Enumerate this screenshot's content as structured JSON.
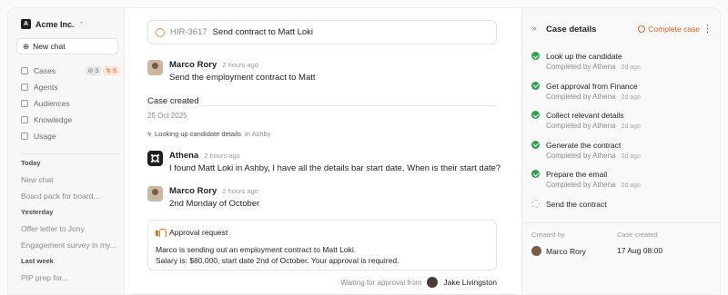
{
  "org": {
    "logo_letter": "A",
    "name": "Acme Inc."
  },
  "sidebar": {
    "new_chat": "New chat",
    "nav": [
      {
        "label": "Cases",
        "icon": "cases-icon",
        "badges": [
          "3",
          "6"
        ]
      },
      {
        "label": "Agents",
        "icon": "agents-icon"
      },
      {
        "label": "Audiences",
        "icon": "audiences-icon"
      },
      {
        "label": "Knowledge",
        "icon": "knowledge-icon"
      },
      {
        "label": "Usage",
        "icon": "usage-icon"
      }
    ],
    "sections": [
      {
        "heading": "Today",
        "items": [
          "New chat",
          "Board pack for board..."
        ]
      },
      {
        "heading": "Yesterday",
        "items": [
          "Offer letter to Jony",
          "Engagement survey in my..."
        ]
      },
      {
        "heading": "Last week",
        "items": [
          "PIP prep for..."
        ]
      }
    ]
  },
  "case": {
    "id": "HIR-3617",
    "title": "Send contract to Matt Loki"
  },
  "messages": [
    {
      "author": "Marco Rory",
      "time": "2 hours ago",
      "body": "Send the employment contract to Matt"
    },
    {
      "author": "Athena",
      "time": "2 hours ago",
      "body": "I found Matt Loki in Ashby, I have all the details bar start date. When is their start date?"
    },
    {
      "author": "Marco Rory",
      "time": "2 hours ago",
      "body": "2nd Monday of October"
    }
  ],
  "case_created": {
    "label": "Case created",
    "date": "25 Oct 2025"
  },
  "lookup": {
    "text": "Looking up candidate details",
    "source": "in Ashby"
  },
  "approval": {
    "title": "Approval request",
    "line1": "Marco is sending out an employment contract to Matt Loki.",
    "line2": "Salary is: $80,000, start date 2nd of October. Your approval is required."
  },
  "waiting": {
    "label": "Waiting for approval from",
    "name": "Jake Livingston"
  },
  "panel": {
    "title": "Case details",
    "complete_label": "Complete case",
    "steps": [
      {
        "title": "Look up the candidate",
        "meta": "Completed by Athena",
        "ago": "2d ago",
        "done": true
      },
      {
        "title": "Get approval from Finance",
        "meta": "Completed by Athena",
        "ago": "2d ago",
        "done": true
      },
      {
        "title": "Collect relevant details",
        "meta": "Completed by Athena",
        "ago": "2d ago",
        "done": true
      },
      {
        "title": "Generate the contract",
        "meta": "Completed by Athena",
        "ago": "2d ago",
        "done": true
      },
      {
        "title": "Prepare the email",
        "meta": "Completed by Athena",
        "ago": "2d ago",
        "done": true
      },
      {
        "title": "Send the contract",
        "done": false
      }
    ],
    "created_by_label": "Created by",
    "created_by": "Marco Rory",
    "case_created_label": "Case created",
    "case_created_value": "17 Aug 08:00"
  },
  "colors": {
    "accent": "#e05f1c",
    "success": "#2fa34a"
  }
}
